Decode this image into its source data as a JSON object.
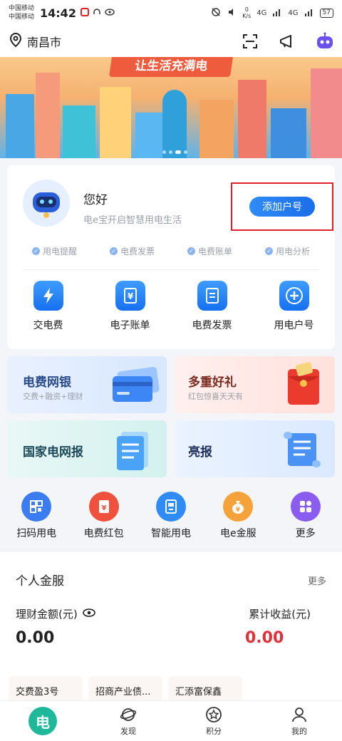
{
  "status_bar": {
    "carrier1": "中国移动",
    "carrier2": "中国移动",
    "time": "14:42",
    "net_speed_value": "0",
    "net_speed_unit": "K/s",
    "signal1": "4G",
    "signal2": "4G",
    "battery": "57"
  },
  "topbar": {
    "city": "南昌市"
  },
  "banner": {
    "title": "让生活充满电"
  },
  "account": {
    "greeting": "您好",
    "subtitle": "电e宝开启智慧用电生活",
    "add_account_label": "添加户号",
    "features": [
      "用电提醒",
      "电费发票",
      "电费账单",
      "用电分析"
    ]
  },
  "quick_actions": [
    {
      "label": "交电费",
      "icon": "lightning-icon"
    },
    {
      "label": "电子账单",
      "icon": "bill-icon"
    },
    {
      "label": "电费发票",
      "icon": "invoice-icon"
    },
    {
      "label": "用电户号",
      "icon": "plus-icon"
    }
  ],
  "tiles": {
    "bank": {
      "title": "电费网银",
      "subtitle": "交费+融资+理财"
    },
    "gift": {
      "title": "多重好礼",
      "subtitle": "红包惊喜天天有"
    },
    "news": {
      "title": "国家电网报"
    },
    "report": {
      "title": "亮报"
    }
  },
  "services": [
    {
      "label": "扫码用电",
      "color": "#3b7cf0",
      "icon": "qr-scan-icon"
    },
    {
      "label": "电费红包",
      "color": "#f0513c",
      "icon": "red-packet-icon"
    },
    {
      "label": "智能用电",
      "color": "#2f8cf7",
      "icon": "smart-meter-icon"
    },
    {
      "label": "电e金服",
      "color": "#f5a23a",
      "icon": "money-bag-icon"
    },
    {
      "label": "更多",
      "color": "#8a5cf0",
      "icon": "grid-icon"
    }
  ],
  "finance": {
    "title": "个人金服",
    "more": "更多",
    "amount_label": "理财金额(元)",
    "amount_value": "0.00",
    "earnings_label": "累计收益(元)",
    "earnings_value": "0.00",
    "products": [
      "交费盈3号",
      "招商产业债...",
      "汇添富保鑫"
    ]
  },
  "nav": {
    "home_glyph": "电",
    "discover": "发现",
    "points": "积分",
    "mine": "我的"
  }
}
